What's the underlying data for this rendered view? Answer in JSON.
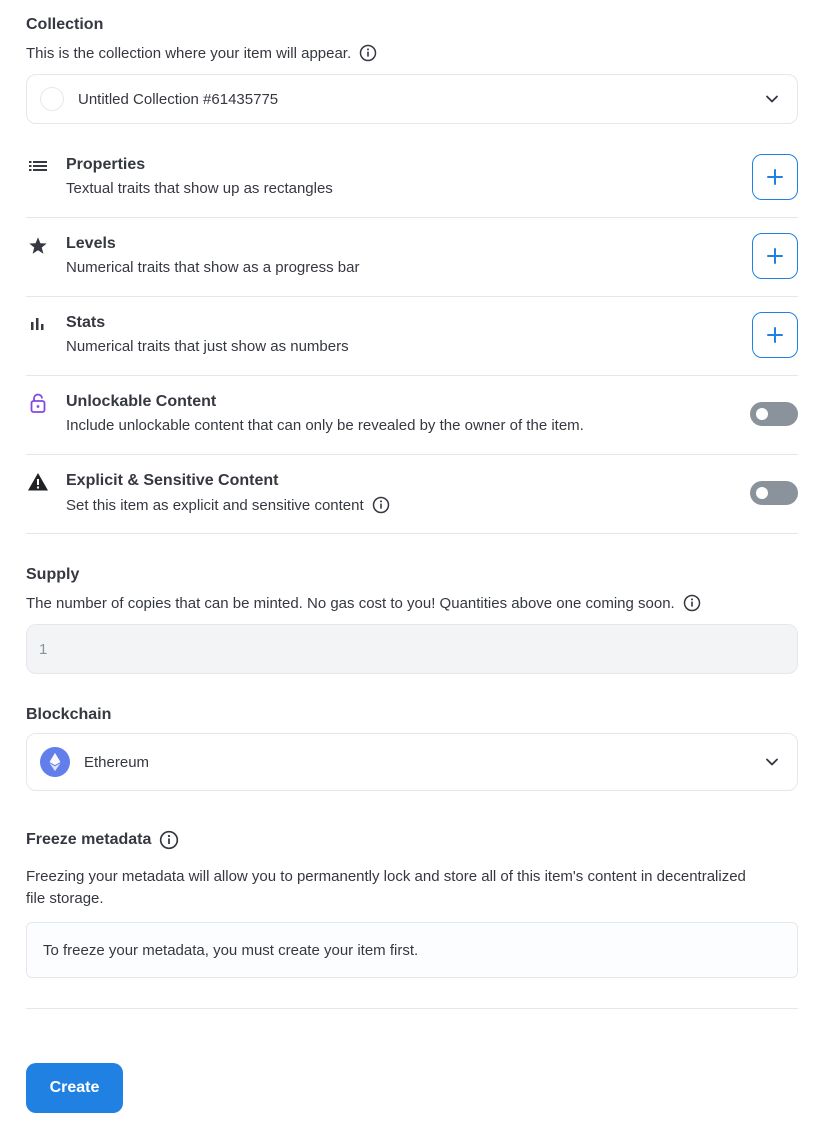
{
  "collection": {
    "title": "Collection",
    "description": "This is the collection where your item will appear.",
    "selected": "Untitled Collection #61435775"
  },
  "traits": [
    {
      "title": "Properties",
      "description": "Textual traits that show up as rectangles",
      "icon": "list-icon",
      "control": "add"
    },
    {
      "title": "Levels",
      "description": "Numerical traits that show as a progress bar",
      "icon": "star-icon",
      "control": "add"
    },
    {
      "title": "Stats",
      "description": "Numerical traits that just show as numbers",
      "icon": "bar-chart-icon",
      "control": "add"
    },
    {
      "title": "Unlockable Content",
      "description": "Include unlockable content that can only be revealed by the owner of the item.",
      "icon": "lock-icon",
      "control": "toggle",
      "toggle_on": false
    },
    {
      "title": "Explicit & Sensitive Content",
      "description": "Set this item as explicit and sensitive content",
      "icon": "warning-icon",
      "control": "toggle",
      "toggle_on": false
    }
  ],
  "supply": {
    "title": "Supply",
    "description": "The number of copies that can be minted. No gas cost to you! Quantities above one coming soon.",
    "value": "1"
  },
  "blockchain": {
    "title": "Blockchain",
    "selected": "Ethereum"
  },
  "freeze": {
    "title": "Freeze metadata",
    "description": "Freezing your metadata will allow you to permanently lock and store all of this item's content in decentralized file storage.",
    "notice": "To freeze your metadata, you must create your item first."
  },
  "actions": {
    "create_label": "Create"
  },
  "colors": {
    "accent": "#2081e2",
    "text": "#353840",
    "border": "#e5e8eb",
    "toggle_off": "#8a939b",
    "lock_icon": "#8247e5",
    "ethereum": "#627eea"
  }
}
